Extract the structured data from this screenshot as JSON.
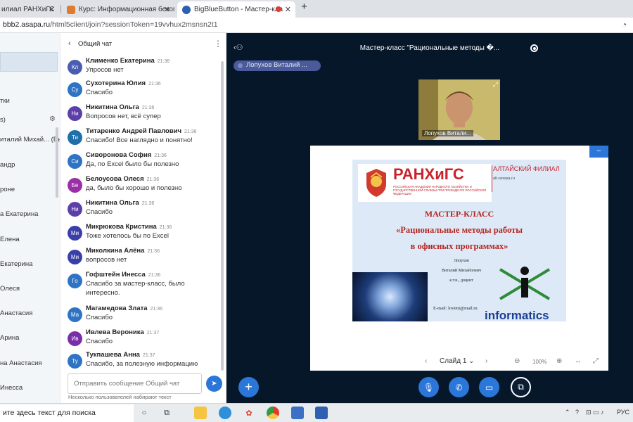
{
  "browser": {
    "tabs": [
      {
        "label": "илиал РАНХиГС",
        "active": false
      },
      {
        "label": "Курс: Информационная безопа",
        "active": false
      },
      {
        "label": "BigBlueButton - Мастер-кла",
        "active": true
      }
    ],
    "new_tab_icon": "plus-icon",
    "url_host": "bbb2.asapa.ru",
    "url_path": "/html5client/join?sessionToken=19vvhux2msnsn2t1"
  },
  "userlist": {
    "items": [
      "тки",
      "s)",
      "италий Михай... (Вы)",
      "андр",
      "ронe",
      "а Екатерина",
      "Елена",
      "Екатерина",
      "Олеся",
      "Анастасия",
      "Арина",
      "на Анастасия",
      "Инесса"
    ]
  },
  "chat": {
    "title": "Общий чат",
    "messages": [
      {
        "initials": "Кл",
        "name": "Клименко Екатерина",
        "time": "21:36",
        "text": "Упросов нет",
        "color": "#4a5db0"
      },
      {
        "initials": "Су",
        "name": "Сухотерина Юлия",
        "time": "21:36",
        "text": "Спасибо",
        "color": "#2f73c4"
      },
      {
        "initials": "Ни",
        "name": "Никитина Ольга",
        "time": "21:36",
        "text": "Вопросов нет, всё супер",
        "color": "#5c3fa8"
      },
      {
        "initials": "Ти",
        "name": "Титаренко Андрей Павлович",
        "time": "21:36",
        "text": "Спасибо! Все наглядно и понятно!",
        "color": "#1f6fa8"
      },
      {
        "initials": "Си",
        "name": "Сиворонова София",
        "time": "21:36",
        "text": "Да, по Excel было бы полезно",
        "color": "#2f73c4"
      },
      {
        "initials": "Бе",
        "name": "Белоусова Олеся",
        "time": "21:36",
        "text": "да, было бы хорошо и полезно",
        "color": "#9a2fa8"
      },
      {
        "initials": "Ни",
        "name": "Никитина Ольга",
        "time": "21:36",
        "text": "Спасибо",
        "color": "#5c3fa8"
      },
      {
        "initials": "Ми",
        "name": "Микрюкова Кристина",
        "time": "21:36",
        "text": "Тоже хотелось бы по Excel",
        "color": "#3a3fa8"
      },
      {
        "initials": "Ми",
        "name": "Миколкина Алёна",
        "time": "21:36",
        "text": "вопросов нет",
        "color": "#3a3fa8"
      },
      {
        "initials": "Го",
        "name": "Гофштейн Инесса",
        "time": "21:36",
        "text": "Спасибо за мастер-класс, было интересно.",
        "color": "#2f73c4"
      },
      {
        "initials": "Ма",
        "name": "Магамедова Злата",
        "time": "21:36",
        "text": "Спасибо",
        "color": "#2f73c4"
      },
      {
        "initials": "Ив",
        "name": "Ивлева Вероника",
        "time": "21:37",
        "text": "Спасибо",
        "color": "#7a2fa8"
      },
      {
        "initials": "Ту",
        "name": "Тукпашева Анна",
        "time": "21:37",
        "text": "Спасибо, за полезную информацию",
        "color": "#2f73c4"
      }
    ],
    "input_placeholder": "Отправить сообщение Общий чат",
    "typing_text": "Несколько пользователей набирают текст"
  },
  "main": {
    "title": "Мастер-класс \"Рациональные методы �...",
    "talking_user": "Лопухов Виталий ...",
    "webcam_label": "Лопухов Витали...",
    "slide": {
      "brand": "РАНХиГС",
      "brand_sub": "РОССИЙСКАЯ АКАДЕМИЯ НАРОДНОГО ХОЗЯЙСТВА И ГОСУДАРСТВЕННОЙ СЛУЖБЫ ПРИ ПРЕЗИДЕНТЕ РОССИЙСКОЙ ФЕДЕРАЦИИ",
      "branch": "АЛТАЙСКИЙ ФИЛИАЛ",
      "branch_url": "alt.ranepa.ru",
      "heading1": "МАСТЕР-КЛАСС",
      "heading2": "«Рациональные методы работы",
      "heading3": "в офисных программах»",
      "author1": "Лопухов",
      "author2": "Виталий Михайлович",
      "author3": "к.т.н., доцент",
      "email": "E-mail: lovimi@mail.ru",
      "informatics": "informatics"
    },
    "slide_label": "Слайд 1",
    "zoom": "100%"
  },
  "taskbar": {
    "search_text": "ите здесь текст для поиска",
    "lang": "РУС"
  },
  "colors": {
    "main_bg": "#06172a",
    "accent": "#2b77d9",
    "slide_red": "#c8232c"
  }
}
